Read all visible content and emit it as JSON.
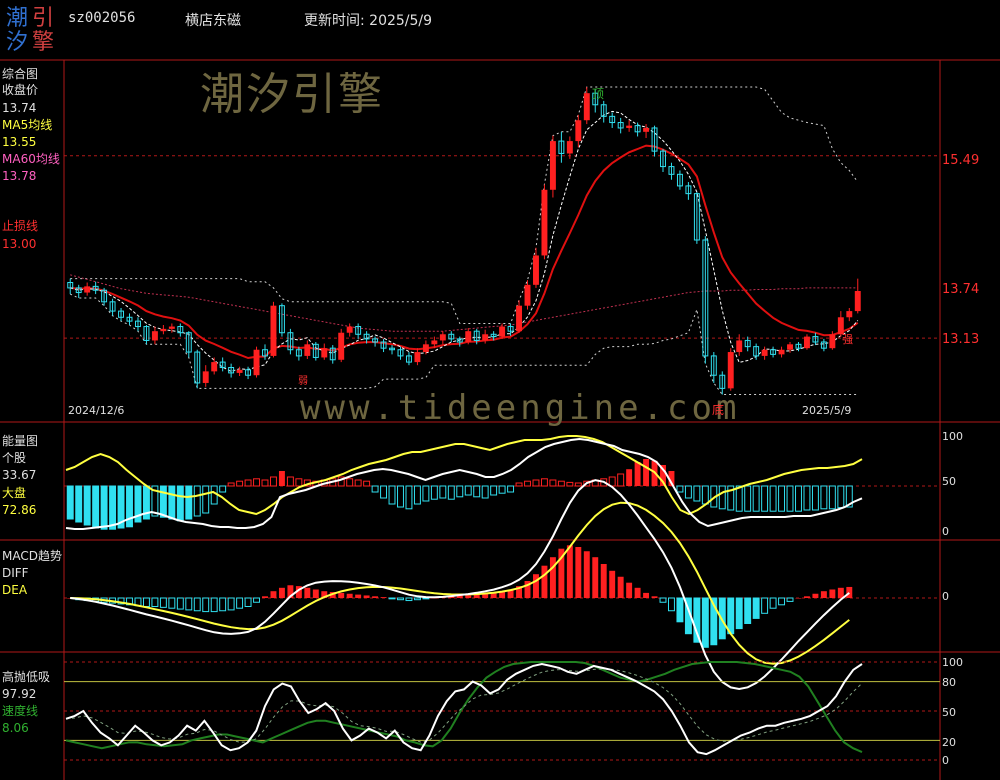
{
  "header": {
    "code": "sz002056",
    "name": "横店东磁",
    "update_label": "更新时间: 2025/5/9",
    "logo_chars": [
      "潮",
      "引",
      "汐",
      "擎"
    ]
  },
  "watermark": {
    "cn": "潮汐引擎",
    "url": "www.tideengine.com"
  },
  "colors": {
    "up": "#ff2020",
    "down": "#30e0f0",
    "white": "#ffffff",
    "yellow": "#ffff40",
    "green": "#208020",
    "red_line": "#e01010",
    "grid": "#b01818"
  },
  "main_panel": {
    "title": "综合图",
    "close_label": "收盘价",
    "close_value": "13.74",
    "ma5_label": "MA5均线",
    "ma5_value": "13.55",
    "ma60_label": "MA60均线",
    "ma60_value": "13.78",
    "stop_label": "止损线",
    "stop_value": "13.00",
    "right_ticks": [
      "15.49",
      "13.74",
      "13.13"
    ],
    "date_start": "2024/12/6",
    "date_end": "2025/5/9",
    "marks": {
      "top": "顶",
      "bottom": "底",
      "weak": "弱",
      "strong": "强"
    }
  },
  "volume_panel": {
    "title": "能量图",
    "stock_label": "个股",
    "stock_value": "33.67",
    "market_label": "大盘",
    "market_value": "72.86",
    "right_ticks": [
      "100",
      "50",
      "0"
    ]
  },
  "macd_panel": {
    "title": "MACD趋势",
    "diff_label": "DIFF",
    "dea_label": "DEA",
    "right_ticks": [
      "0"
    ]
  },
  "osc_panel": {
    "title": "高抛低吸",
    "value": "97.92",
    "speed_label": "速度线",
    "speed_value": "8.06",
    "right_ticks": [
      "100",
      "80",
      "50",
      "20",
      "0"
    ]
  },
  "chart_data": {
    "type": "candlestick",
    "x_start": "2024/12/6",
    "x_end": "2025/5/9",
    "price_ylim": [
      12.2,
      16.6
    ],
    "candles": [
      [
        13.85,
        13.78,
        13.9,
        13.7
      ],
      [
        13.78,
        13.72,
        13.82,
        13.65
      ],
      [
        13.72,
        13.8,
        13.85,
        13.68
      ],
      [
        13.8,
        13.75,
        13.86,
        13.7
      ],
      [
        13.75,
        13.6,
        13.78,
        13.55
      ],
      [
        13.6,
        13.48,
        13.64,
        13.42
      ],
      [
        13.48,
        13.4,
        13.52,
        13.35
      ],
      [
        13.4,
        13.35,
        13.45,
        13.3
      ],
      [
        13.35,
        13.28,
        13.4,
        13.22
      ],
      [
        13.28,
        13.1,
        13.3,
        13.05
      ],
      [
        13.1,
        13.22,
        13.28,
        13.05
      ],
      [
        13.22,
        13.25,
        13.3,
        13.18
      ],
      [
        13.25,
        13.28,
        13.32,
        13.2
      ],
      [
        13.28,
        13.2,
        13.32,
        13.15
      ],
      [
        13.2,
        12.95,
        13.22,
        12.88
      ],
      [
        12.95,
        12.55,
        12.98,
        12.48
      ],
      [
        12.55,
        12.7,
        12.78,
        12.5
      ],
      [
        12.7,
        12.82,
        12.88,
        12.66
      ],
      [
        12.82,
        12.75,
        12.88,
        12.7
      ],
      [
        12.75,
        12.68,
        12.8,
        12.62
      ],
      [
        12.68,
        12.72,
        12.76,
        12.64
      ],
      [
        12.72,
        12.65,
        12.76,
        12.6
      ],
      [
        12.65,
        12.98,
        13.02,
        12.62
      ],
      [
        12.98,
        12.9,
        13.05,
        12.85
      ],
      [
        12.9,
        13.55,
        13.6,
        12.88
      ],
      [
        13.55,
        13.2,
        13.58,
        13.15
      ],
      [
        13.2,
        12.98,
        13.25,
        12.92
      ],
      [
        12.98,
        12.9,
        13.02,
        12.84
      ],
      [
        12.9,
        13.05,
        13.1,
        12.86
      ],
      [
        13.05,
        12.88,
        13.08,
        12.84
      ],
      [
        12.88,
        13.0,
        13.06,
        12.85
      ],
      [
        13.0,
        12.85,
        13.04,
        12.8
      ],
      [
        12.85,
        13.2,
        13.25,
        12.82
      ],
      [
        13.2,
        13.28,
        13.32,
        13.15
      ],
      [
        13.28,
        13.18,
        13.32,
        13.12
      ],
      [
        13.18,
        13.12,
        13.22,
        13.06
      ],
      [
        13.12,
        13.08,
        13.15,
        13.02
      ],
      [
        13.08,
        13.0,
        13.12,
        12.95
      ],
      [
        13.0,
        12.98,
        13.04,
        12.92
      ],
      [
        12.98,
        12.9,
        13.02,
        12.85
      ],
      [
        12.9,
        12.82,
        12.95,
        12.78
      ],
      [
        12.82,
        12.95,
        13.0,
        12.78
      ],
      [
        12.95,
        13.05,
        13.1,
        12.92
      ],
      [
        13.05,
        13.1,
        13.15,
        13.0
      ],
      [
        13.1,
        13.18,
        13.22,
        13.05
      ],
      [
        13.18,
        13.12,
        13.22,
        13.08
      ],
      [
        13.12,
        13.08,
        13.15,
        13.02
      ],
      [
        13.08,
        13.22,
        13.26,
        13.05
      ],
      [
        13.22,
        13.1,
        13.25,
        13.05
      ],
      [
        13.1,
        13.18,
        13.24,
        13.06
      ],
      [
        13.18,
        13.15,
        13.22,
        13.1
      ],
      [
        13.15,
        13.28,
        13.32,
        13.12
      ],
      [
        13.28,
        13.22,
        13.32,
        13.16
      ],
      [
        13.22,
        13.55,
        13.62,
        13.2
      ],
      [
        13.55,
        13.82,
        13.88,
        13.5
      ],
      [
        13.82,
        14.2,
        14.3,
        13.78
      ],
      [
        14.2,
        15.05,
        15.12,
        14.15
      ],
      [
        15.05,
        15.68,
        15.75,
        14.95
      ],
      [
        15.68,
        15.52,
        15.8,
        15.4
      ],
      [
        15.52,
        15.68,
        15.74,
        15.45
      ],
      [
        15.68,
        15.95,
        16.02,
        15.6
      ],
      [
        15.95,
        16.3,
        16.38,
        15.9
      ],
      [
        16.3,
        16.15,
        16.35,
        16.05
      ],
      [
        16.15,
        16.0,
        16.2,
        15.92
      ],
      [
        16.0,
        15.92,
        16.05,
        15.85
      ],
      [
        15.92,
        15.85,
        15.98,
        15.78
      ],
      [
        15.85,
        15.88,
        15.95,
        15.8
      ],
      [
        15.88,
        15.8,
        15.92,
        15.74
      ],
      [
        15.8,
        15.85,
        15.9,
        15.72
      ],
      [
        15.85,
        15.55,
        15.88,
        15.48
      ],
      [
        15.55,
        15.35,
        15.58,
        15.28
      ],
      [
        15.35,
        15.25,
        15.4,
        15.18
      ],
      [
        15.25,
        15.1,
        15.3,
        15.05
      ],
      [
        15.1,
        15.0,
        15.15,
        14.92
      ],
      [
        15.0,
        14.4,
        15.02,
        14.35
      ],
      [
        14.4,
        12.9,
        14.45,
        12.8
      ],
      [
        12.9,
        12.65,
        12.95,
        12.55
      ],
      [
        12.65,
        12.48,
        12.7,
        12.4
      ],
      [
        12.48,
        12.95,
        13.0,
        12.45
      ],
      [
        12.95,
        13.1,
        13.18,
        12.9
      ],
      [
        13.1,
        13.02,
        13.15,
        12.96
      ],
      [
        13.02,
        12.9,
        13.06,
        12.85
      ],
      [
        12.9,
        12.98,
        13.02,
        12.85
      ],
      [
        12.98,
        12.92,
        13.02,
        12.88
      ],
      [
        12.92,
        12.98,
        13.02,
        12.88
      ],
      [
        12.98,
        13.05,
        13.08,
        12.94
      ],
      [
        13.05,
        13.0,
        13.08,
        12.96
      ],
      [
        13.0,
        13.15,
        13.18,
        12.98
      ],
      [
        13.15,
        13.08,
        13.2,
        13.04
      ],
      [
        13.08,
        13.0,
        13.12,
        12.96
      ],
      [
        13.0,
        13.18,
        13.22,
        12.98
      ],
      [
        13.18,
        13.4,
        13.48,
        13.15
      ],
      [
        13.4,
        13.48,
        13.52,
        13.35
      ],
      [
        13.48,
        13.74,
        13.9,
        13.45
      ]
    ],
    "ma60": [
      13.95,
      13.92,
      13.89,
      13.86,
      13.83,
      13.8,
      13.77,
      13.75,
      13.73,
      13.71,
      13.7,
      13.69,
      13.68,
      13.67,
      13.66,
      13.64,
      13.62,
      13.6,
      13.58,
      13.56,
      13.54,
      13.52,
      13.5,
      13.48,
      13.46,
      13.44,
      13.42,
      13.4,
      13.38,
      13.36,
      13.34,
      13.32,
      13.3,
      13.28,
      13.26,
      13.25,
      13.24,
      13.23,
      13.22,
      13.22,
      13.22,
      13.22,
      13.22,
      13.22,
      13.22,
      13.23,
      13.24,
      13.25,
      13.26,
      13.27,
      13.28,
      13.29,
      13.3,
      13.32,
      13.34,
      13.36,
      13.38,
      13.4,
      13.42,
      13.44,
      13.46,
      13.48,
      13.5,
      13.52,
      13.54,
      13.56,
      13.58,
      13.6,
      13.62,
      13.64,
      13.66,
      13.68,
      13.7,
      13.72,
      13.73,
      13.74,
      13.74,
      13.74,
      13.75,
      13.75,
      13.75,
      13.76,
      13.76,
      13.76,
      13.77,
      13.77,
      13.77,
      13.78,
      13.78,
      13.78,
      13.78,
      13.78,
      13.78,
      13.78
    ],
    "volume_bars": [
      -0.55,
      -0.6,
      -0.65,
      -0.7,
      -0.72,
      -0.72,
      -0.7,
      -0.68,
      -0.6,
      -0.55,
      -0.5,
      -0.52,
      -0.55,
      -0.58,
      -0.55,
      -0.5,
      -0.45,
      -0.3,
      -0.1,
      0.05,
      0.08,
      0.1,
      0.12,
      0.1,
      0.15,
      0.25,
      0.15,
      0.12,
      0.1,
      0.08,
      0.1,
      0.12,
      0.15,
      0.12,
      0.1,
      0.08,
      -0.1,
      -0.2,
      -0.3,
      -0.35,
      -0.38,
      -0.3,
      -0.25,
      -0.22,
      -0.2,
      -0.22,
      -0.18,
      -0.15,
      -0.18,
      -0.2,
      -0.15,
      -0.12,
      -0.1,
      0.05,
      0.08,
      0.1,
      0.12,
      0.1,
      0.08,
      0.06,
      0.05,
      0.08,
      0.1,
      0.12,
      0.15,
      0.2,
      0.28,
      0.4,
      0.45,
      0.42,
      0.35,
      0.25,
      -0.1,
      -0.2,
      -0.25,
      -0.3,
      -0.35,
      -0.38,
      -0.4,
      -0.42,
      -0.42,
      -0.42,
      -0.42,
      -0.42,
      -0.42,
      -0.42,
      -0.42,
      -0.4,
      -0.4,
      -0.38,
      -0.38,
      -0.36,
      -0.35
    ],
    "volume_stock": [
      4,
      3,
      3,
      4,
      5,
      6,
      8,
      12,
      15,
      18,
      20,
      18,
      15,
      12,
      10,
      9,
      8,
      6,
      5,
      5,
      4,
      4,
      5,
      8,
      15,
      35,
      38,
      40,
      42,
      45,
      48,
      50,
      52,
      55,
      58,
      60,
      62,
      63,
      62,
      60,
      58,
      55,
      52,
      55,
      58,
      60,
      62,
      60,
      58,
      55,
      55,
      58,
      62,
      68,
      75,
      80,
      85,
      88,
      90,
      92,
      93,
      92,
      90,
      88,
      86,
      82,
      80,
      78,
      75,
      70,
      60,
      45,
      30,
      18,
      10,
      6,
      8,
      10,
      12,
      14,
      15,
      15,
      15,
      15,
      15,
      16,
      16,
      16,
      18,
      20,
      22,
      25,
      30,
      33.67
    ],
    "volume_market": [
      62,
      65,
      70,
      75,
      78,
      75,
      70,
      62,
      55,
      48,
      42,
      40,
      38,
      36,
      35,
      36,
      38,
      40,
      35,
      28,
      22,
      20,
      18,
      22,
      28,
      35,
      40,
      45,
      48,
      50,
      52,
      55,
      58,
      62,
      65,
      68,
      70,
      72,
      75,
      78,
      80,
      80,
      82,
      84,
      86,
      88,
      88,
      86,
      84,
      82,
      85,
      88,
      90,
      92,
      92,
      92,
      93,
      95,
      96,
      96,
      95,
      93,
      90,
      85,
      80,
      75,
      70,
      65,
      60,
      50,
      35,
      22,
      18,
      22,
      28,
      35,
      40,
      42,
      45,
      48,
      50,
      52,
      55,
      58,
      60,
      62,
      63,
      64,
      64,
      65,
      66,
      68,
      72.86
    ],
    "macd_bars": [
      0,
      -0.02,
      -0.03,
      -0.04,
      -0.05,
      -0.06,
      -0.07,
      -0.08,
      -0.09,
      -0.1,
      -0.1,
      -0.11,
      -0.12,
      -0.13,
      -0.14,
      -0.15,
      -0.16,
      -0.16,
      -0.15,
      -0.14,
      -0.12,
      -0.1,
      -0.05,
      0.02,
      0.08,
      0.12,
      0.15,
      0.14,
      0.12,
      0.1,
      0.08,
      0.07,
      0.06,
      0.05,
      0.04,
      0.03,
      0.02,
      0.01,
      -0.01,
      -0.02,
      -0.03,
      -0.02,
      -0.01,
      0.0,
      0.01,
      0.02,
      0.03,
      0.03,
      0.04,
      0.05,
      0.06,
      0.08,
      0.1,
      0.14,
      0.2,
      0.28,
      0.38,
      0.48,
      0.58,
      0.62,
      0.6,
      0.55,
      0.48,
      0.4,
      0.32,
      0.25,
      0.18,
      0.12,
      0.06,
      0.02,
      -0.05,
      -0.15,
      -0.28,
      -0.42,
      -0.52,
      -0.58,
      -0.55,
      -0.48,
      -0.42,
      -0.36,
      -0.3,
      -0.24,
      -0.18,
      -0.12,
      -0.08,
      -0.04,
      0.0,
      0.02,
      0.05,
      0.08,
      0.1,
      0.12,
      0.13
    ],
    "osc_white": [
      42,
      45,
      50,
      38,
      28,
      22,
      15,
      25,
      35,
      28,
      20,
      15,
      18,
      25,
      35,
      30,
      40,
      28,
      15,
      10,
      12,
      18,
      30,
      55,
      72,
      78,
      75,
      60,
      48,
      52,
      58,
      50,
      32,
      20,
      25,
      32,
      28,
      22,
      30,
      18,
      12,
      10,
      25,
      45,
      60,
      70,
      72,
      80,
      76,
      68,
      72,
      82,
      88,
      92,
      96,
      98,
      96,
      94,
      90,
      88,
      92,
      96,
      94,
      92,
      88,
      84,
      80,
      75,
      70,
      62,
      50,
      35,
      18,
      8,
      6,
      10,
      15,
      20,
      25,
      28,
      32,
      35,
      35,
      38,
      40,
      42,
      45,
      50,
      55,
      65,
      80,
      92,
      97.92
    ],
    "osc_speed": [
      20,
      18,
      16,
      14,
      12,
      14,
      16,
      18,
      18,
      16,
      15,
      14,
      15,
      16,
      20,
      22,
      24,
      26,
      26,
      24,
      22,
      20,
      18,
      22,
      26,
      30,
      34,
      38,
      40,
      40,
      38,
      36,
      34,
      32,
      30,
      28,
      26,
      24,
      20,
      18,
      15,
      14,
      20,
      32,
      48,
      62,
      74,
      84,
      90,
      95,
      98,
      99,
      100,
      100,
      100,
      100,
      100,
      100,
      99,
      96,
      92,
      88,
      84,
      82,
      80,
      82,
      85,
      88,
      92,
      95,
      98,
      99,
      100,
      100,
      100,
      100,
      99,
      98,
      96,
      94,
      92,
      90,
      85,
      75,
      60,
      45,
      30,
      18,
      12,
      8.06
    ]
  }
}
